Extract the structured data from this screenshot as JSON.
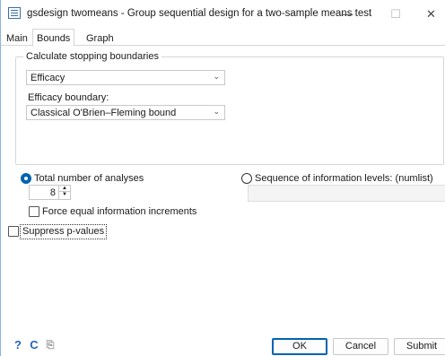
{
  "window": {
    "title": "gsdesign twomeans - Group sequential design for a two-sample means test",
    "minimize": "—",
    "maximize": "☐",
    "close": "✕"
  },
  "tabs": [
    {
      "label": "Main",
      "active": false
    },
    {
      "label": "Bounds",
      "active": true
    },
    {
      "label": "Graph",
      "active": false
    }
  ],
  "stopping": {
    "group_label": "Calculate stopping boundaries",
    "selected": "Efficacy",
    "efficacy_label": "Efficacy boundary:",
    "efficacy_selected": "Classical O'Brien–Fleming bound"
  },
  "analyses": {
    "total_label": "Total number of analyses",
    "total_value": "8",
    "sequence_label": "Sequence of information levels: (numlist)",
    "sequence_value": "",
    "force_equal_label": "Force equal information increments",
    "force_equal_checked": false
  },
  "suppress": {
    "label": "Suppress p-values",
    "checked": false
  },
  "buttons": {
    "help": "?",
    "reset": "C",
    "copy": "⎘",
    "ok": "OK",
    "cancel": "Cancel",
    "submit": "Submit"
  },
  "colors": {
    "accent": "#0063b1",
    "border": "#c8c8c8"
  }
}
